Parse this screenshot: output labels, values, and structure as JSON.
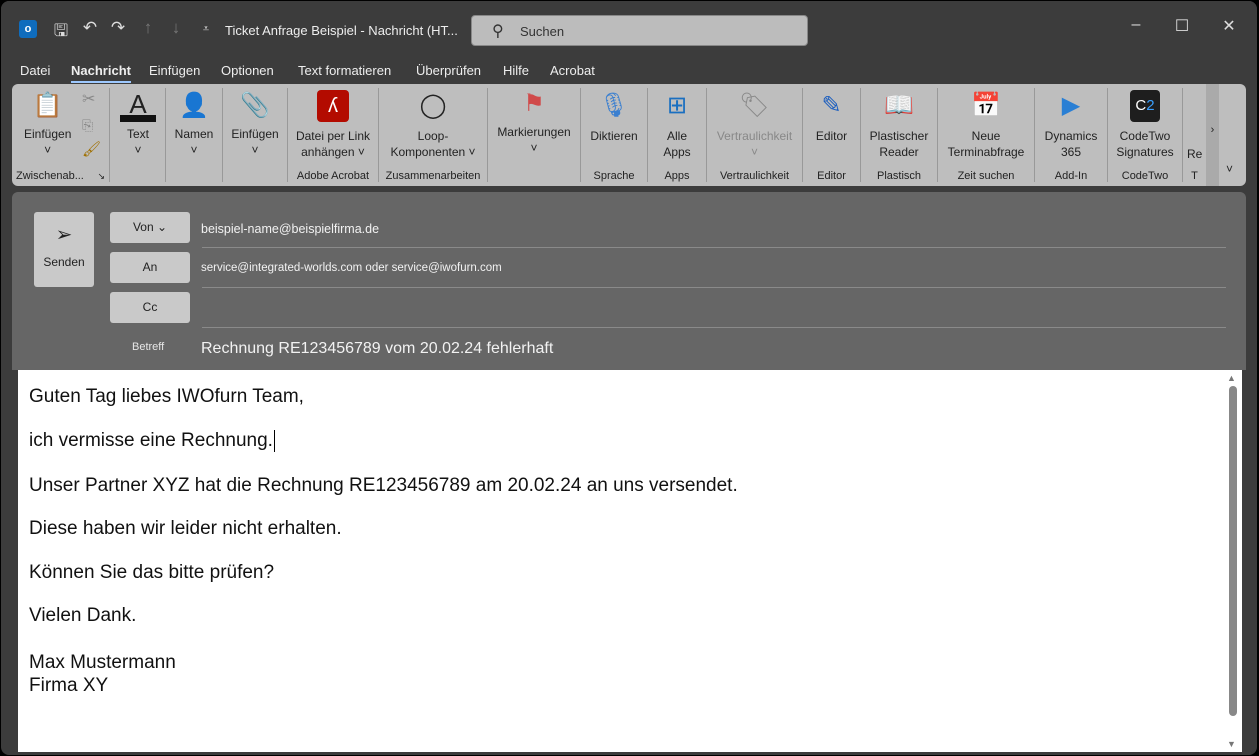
{
  "titlebar": {
    "title": "Ticket Anfrage Beispiel  -  Nachricht (HT...",
    "search_placeholder": "Suchen"
  },
  "tabs": [
    "Datei",
    "Nachricht",
    "Einfügen",
    "Optionen",
    "Text formatieren",
    "Überprüfen",
    "Hilfe",
    "Acrobat"
  ],
  "active_tab": "Nachricht",
  "ribbon": {
    "clipboard": {
      "paste": "Einfügen",
      "label": "Zwischenab..."
    },
    "text": "Text",
    "namen": "Namen",
    "einfuegen": "Einfügen",
    "adobe": {
      "l1": "Datei per Link",
      "l2": "anhängen ˅",
      "label": "Adobe Acrobat"
    },
    "loop": {
      "l1": "Loop-",
      "l2": "Komponenten ˅",
      "label": "Zusammenarbeiten"
    },
    "markierungen": "Markierungen",
    "diktieren": {
      "btn": "Diktieren",
      "label": "Sprache"
    },
    "apps": {
      "l1": "Alle",
      "l2": "Apps",
      "label": "Apps"
    },
    "vertraulichkeit": {
      "btn": "Vertraulichkeit",
      "label": "Vertraulichkeit"
    },
    "editor": {
      "btn": "Editor",
      "label": "Editor"
    },
    "plastisch": {
      "l1": "Plastischer",
      "l2": "Reader",
      "label": "Plastisch"
    },
    "zeit": {
      "l1": "Neue",
      "l2": "Terminabfrage",
      "label": "Zeit suchen"
    },
    "dynamics": {
      "l1": "Dynamics",
      "l2": "365",
      "label": "Add-In"
    },
    "codetwo": {
      "l1": "CodeTwo",
      "l2": "Signatures",
      "label": "CodeTwo",
      "logo": "C2"
    },
    "partial": {
      "btn": "Re",
      "label": "T"
    }
  },
  "compose": {
    "send": "Senden",
    "from_btn": "Von",
    "to_btn": "An",
    "cc_btn": "Cc",
    "subject_label": "Betreff",
    "from": "beispiel-name@beispielfirma.de",
    "to": "service@integrated-worlds.com oder service@iwofurn.com",
    "cc": "",
    "subject": "Rechnung RE123456789 vom 20.02.24 fehlerhaft"
  },
  "body": {
    "lines": [
      "Guten Tag liebes IWOfurn Team,",
      "ich vermisse eine Rechnung.",
      "Unser Partner XYZ hat die Rechnung RE123456789 am 20.02.24 an uns versendet.",
      "Diese haben wir leider nicht erhalten.",
      "Können Sie das bitte prüfen?",
      "Vielen Dank.",
      "Max Mustermann",
      "Firma XY"
    ]
  },
  "colors": {
    "accent": "#9ec9ff",
    "adobe": "#b30b00",
    "ribbon": "#bebebe",
    "compose": "#666666"
  }
}
